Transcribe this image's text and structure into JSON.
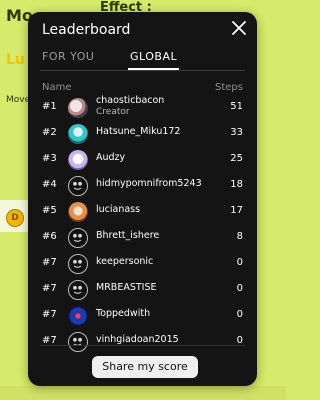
{
  "background": {
    "title_fragment": "Mo",
    "effect_label": "Effect :",
    "lu_fragment": "Lu",
    "move_fragment": "Move",
    "coin_glyph": "D"
  },
  "modal": {
    "title": "Leaderboard",
    "close_icon": "close-icon",
    "tabs": [
      {
        "label": "FOR YOU",
        "active": false
      },
      {
        "label": "GLOBAL",
        "active": true
      }
    ],
    "columns": {
      "name": "Name",
      "steps": "Steps"
    },
    "rows": [
      {
        "rank": "#1",
        "name": "chaosticbacon",
        "subtitle": "Creator",
        "steps": "51",
        "avatar": "photo"
      },
      {
        "rank": "#2",
        "name": "Hatsune_Miku172",
        "subtitle": "",
        "steps": "33",
        "avatar": "photo"
      },
      {
        "rank": "#3",
        "name": "Audzy",
        "subtitle": "",
        "steps": "25",
        "avatar": "photo"
      },
      {
        "rank": "#4",
        "name": "hidmypomnifrom5243",
        "subtitle": "",
        "steps": "18",
        "avatar": "default"
      },
      {
        "rank": "#5",
        "name": "lucianass",
        "subtitle": "",
        "steps": "17",
        "avatar": "photo"
      },
      {
        "rank": "#6",
        "name": "Bhrett_ishere",
        "subtitle": "",
        "steps": "8",
        "avatar": "default"
      },
      {
        "rank": "#7",
        "name": "keepersonic",
        "subtitle": "",
        "steps": "0",
        "avatar": "default"
      },
      {
        "rank": "#7",
        "name": "MRBEASTISE",
        "subtitle": "",
        "steps": "0",
        "avatar": "default"
      },
      {
        "rank": "#7",
        "name": "Toppedwith",
        "subtitle": "",
        "steps": "0",
        "avatar": "photo"
      },
      {
        "rank": "#7",
        "name": "vinhgiadoan2015",
        "subtitle": "",
        "steps": "0",
        "avatar": "default"
      }
    ],
    "share_button": "Share my score"
  },
  "colors": {
    "background": "#d6ea6b",
    "modal": "#141414",
    "button": "#efefef"
  }
}
